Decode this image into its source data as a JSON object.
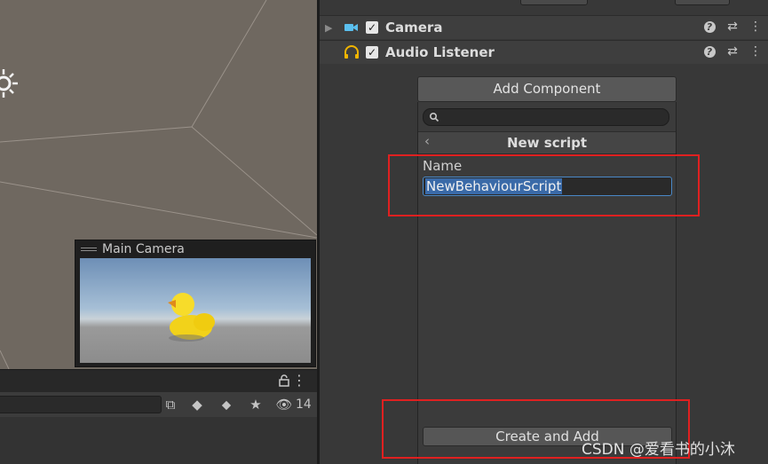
{
  "scene": {
    "camera_preview": {
      "title": "Main Camera"
    }
  },
  "project_panel": {
    "toolbar": {
      "hidden_count": "14"
    },
    "icons": [
      "lock-icon",
      "more-menu-icon",
      "search-scope-icon",
      "asset-type-icon",
      "label-icon",
      "star-icon",
      "eye-hidden-icon"
    ]
  },
  "inspector": {
    "components": [
      {
        "name": "Camera",
        "icon": "video-camera-icon",
        "enabled": true
      },
      {
        "name": "Audio Listener",
        "icon": "headphones-icon",
        "enabled": true
      }
    ],
    "add_component_label": "Add Component",
    "popup": {
      "header_title": "New script",
      "name_label": "Name",
      "name_value": "NewBehaviourScript",
      "create_label": "Create and Add"
    }
  },
  "watermark": "CSDN @爱看书的小沐",
  "colors": {
    "annotation_red": "#e02020",
    "selection_blue": "#3a6aa8",
    "camera_icon": "#5bc0ef",
    "headphones_icon": "#f0b400"
  }
}
